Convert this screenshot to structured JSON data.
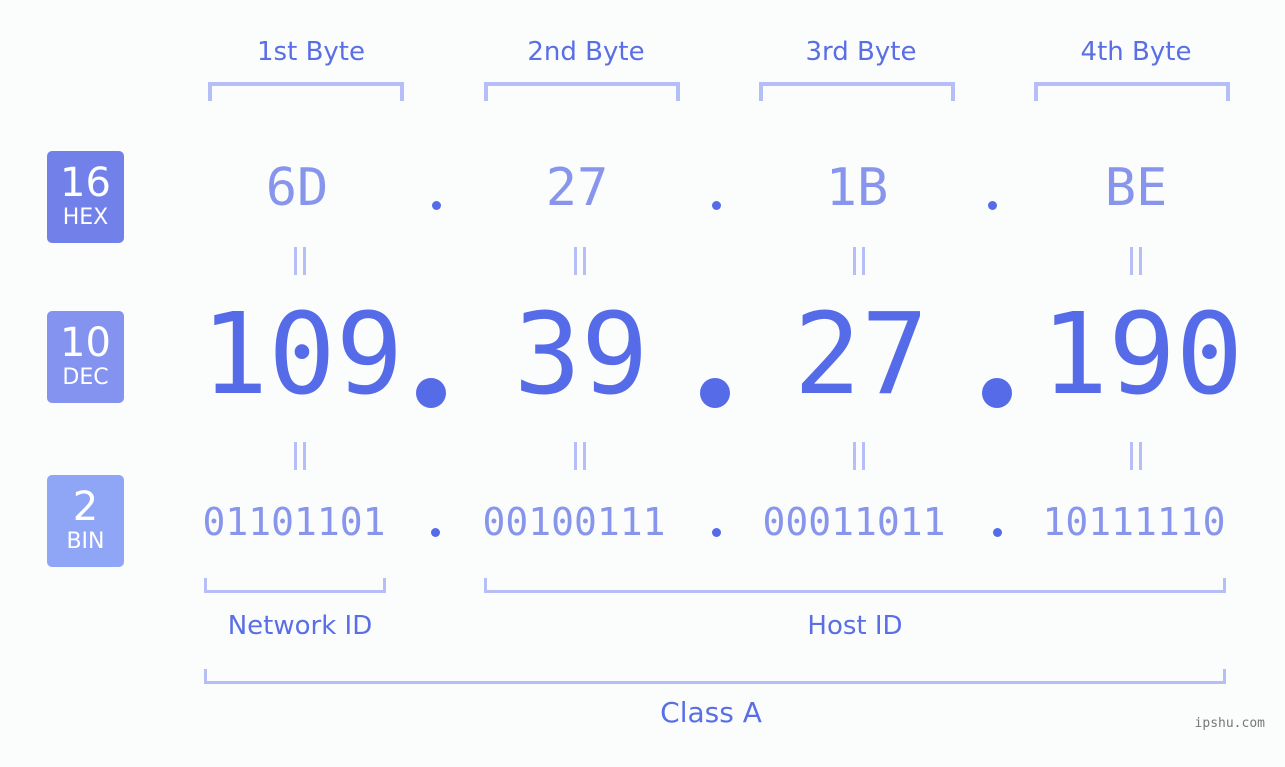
{
  "bytes": [
    {
      "header": "1st Byte",
      "hex": "6D",
      "dec": "109",
      "bin": "01101101"
    },
    {
      "header": "2nd Byte",
      "hex": "27",
      "dec": "39",
      "bin": "00100111"
    },
    {
      "header": "3rd Byte",
      "hex": "1B",
      "dec": "27",
      "bin": "00011011"
    },
    {
      "header": "4th Byte",
      "hex": "BE",
      "dec": "190",
      "bin": "10111110"
    }
  ],
  "badges": {
    "hex": {
      "num": "16",
      "label": "HEX",
      "color": "#7280ea"
    },
    "dec": {
      "num": "10",
      "label": "DEC",
      "color": "#8593f0"
    },
    "bin": {
      "num": "2",
      "label": "BIN",
      "color": "#8fa6f7"
    }
  },
  "labels": {
    "network_id": "Network ID",
    "host_id": "Host ID",
    "class": "Class A"
  },
  "watermark": "ipshu.com",
  "colors": {
    "accent": "#566be8",
    "light": "#8895ed",
    "bracket": "#b5bef7"
  }
}
